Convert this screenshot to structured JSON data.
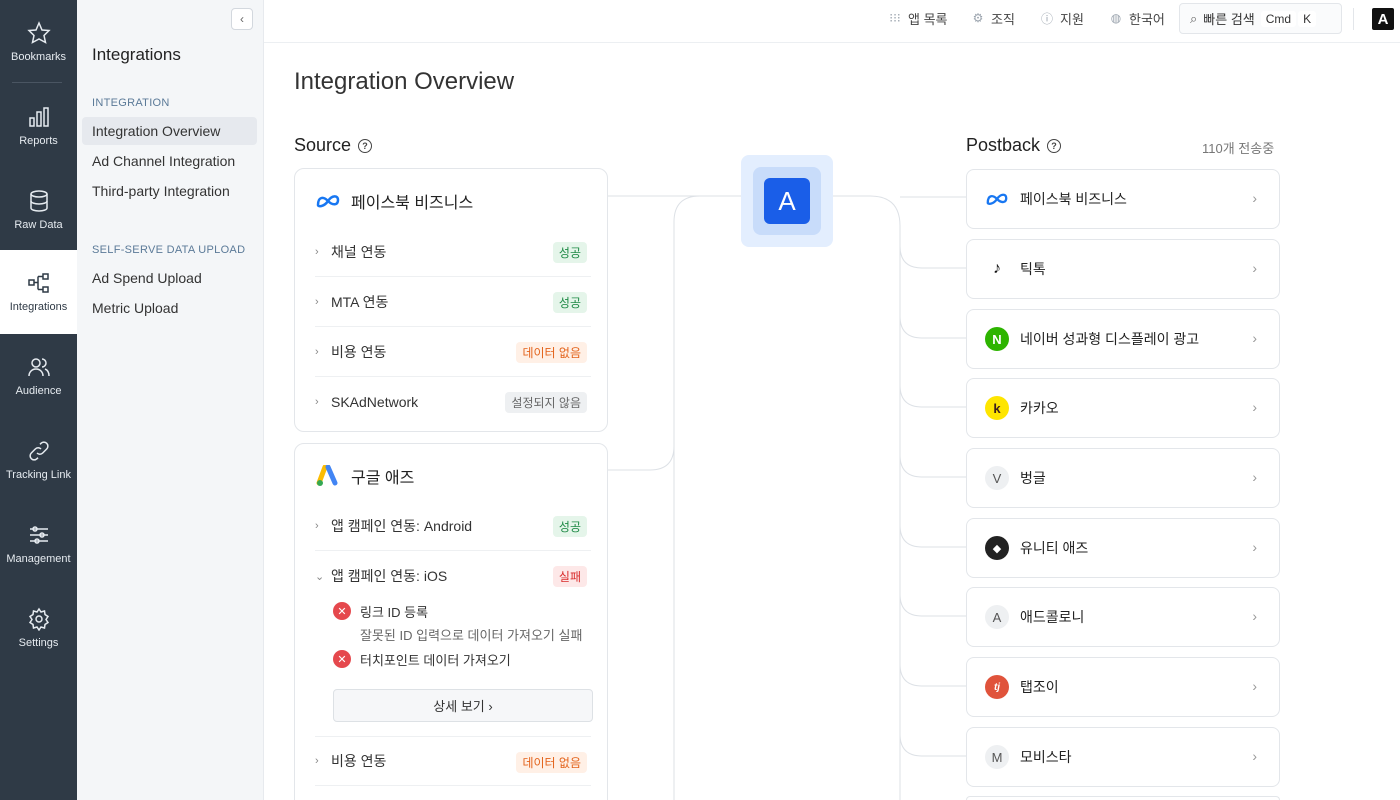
{
  "rail": {
    "items": [
      {
        "label": "Bookmarks",
        "icon": "star-icon"
      },
      {
        "label": "Reports",
        "icon": "bar-chart-icon"
      },
      {
        "label": "Raw Data",
        "icon": "database-icon"
      },
      {
        "label": "Integrations",
        "icon": "integration-tree-icon"
      },
      {
        "label": "Audience",
        "icon": "users-icon"
      },
      {
        "label": "Tracking Link",
        "icon": "link-icon"
      },
      {
        "label": "Management",
        "icon": "sliders-icon"
      },
      {
        "label": "Settings",
        "icon": "gear-icon"
      }
    ]
  },
  "subnav": {
    "title": "Integrations",
    "sections": [
      {
        "heading": "INTEGRATION",
        "items": [
          "Integration Overview",
          "Ad Channel Integration",
          "Third-party Integration"
        ]
      },
      {
        "heading": "SELF-SERVE DATA UPLOAD",
        "items": [
          "Ad Spend Upload",
          "Metric Upload"
        ]
      }
    ],
    "collapse_glyph": "‹"
  },
  "topbar": {
    "app_list": "앱 목록",
    "org": "조직",
    "support": "지원",
    "language": "한국어",
    "search_label": "빠른 검색",
    "kbd_cmd": "Cmd",
    "kbd_k": "K",
    "logo_letter": "A"
  },
  "page": {
    "title": "Integration Overview"
  },
  "source": {
    "title": "Source",
    "help": "?",
    "facebook": {
      "name": "페이스북 비즈니스",
      "rows": [
        {
          "label": "채널 연동",
          "status": "성공"
        },
        {
          "label": "MTA 연동",
          "status": "성공"
        },
        {
          "label": "비용 연동",
          "status": "데이터 없음"
        },
        {
          "label": "SKAdNetwork",
          "status": "설정되지 않음"
        }
      ]
    },
    "google": {
      "name": "구글 애즈",
      "rows": [
        {
          "label": "앱 캠페인 연동: Android",
          "status": "성공"
        },
        {
          "label": "앱 캠페인 연동: iOS",
          "status": "실패"
        },
        {
          "label": "비용 연동",
          "status": "데이터 없음"
        }
      ],
      "errors": [
        {
          "title": "링크 ID 등록",
          "desc": "잘못된 ID 입력으로 데이터 가져오기 실패"
        },
        {
          "title": "터치포인트 데이터 가져오기",
          "desc": ""
        }
      ],
      "detail_button": "상세 보기 ›"
    }
  },
  "hub": {
    "letter": "A"
  },
  "postback": {
    "title": "Postback",
    "help": "?",
    "count": "110개 전송중",
    "items": [
      {
        "name": "페이스북 비즈니스",
        "logo": "meta-logo-icon",
        "glyph": "∞"
      },
      {
        "name": "틱톡",
        "logo": "tiktok-logo-icon",
        "glyph": "♪"
      },
      {
        "name": "네이버 성과형 디스플레이 광고",
        "logo": "naver-logo-icon",
        "glyph": "N"
      },
      {
        "name": "카카오",
        "logo": "kakao-logo-icon",
        "glyph": "k"
      },
      {
        "name": "벙글",
        "logo": "vungle-logo-icon",
        "glyph": "V"
      },
      {
        "name": "유니티 애즈",
        "logo": "unity-logo-icon",
        "glyph": "◆"
      },
      {
        "name": "애드콜로니",
        "logo": "adcolony-logo-icon",
        "glyph": "A"
      },
      {
        "name": "탭조이",
        "logo": "tapjoy-logo-icon",
        "glyph": "tj"
      },
      {
        "name": "모비스타",
        "logo": "mobvista-logo-icon",
        "glyph": "M"
      }
    ]
  },
  "colors": {
    "rail_bg": "#2f3a46",
    "accent_blue": "#1a5ee8",
    "success": "#1f8a46",
    "warning": "#e3631b",
    "error": "#d92b2b"
  }
}
